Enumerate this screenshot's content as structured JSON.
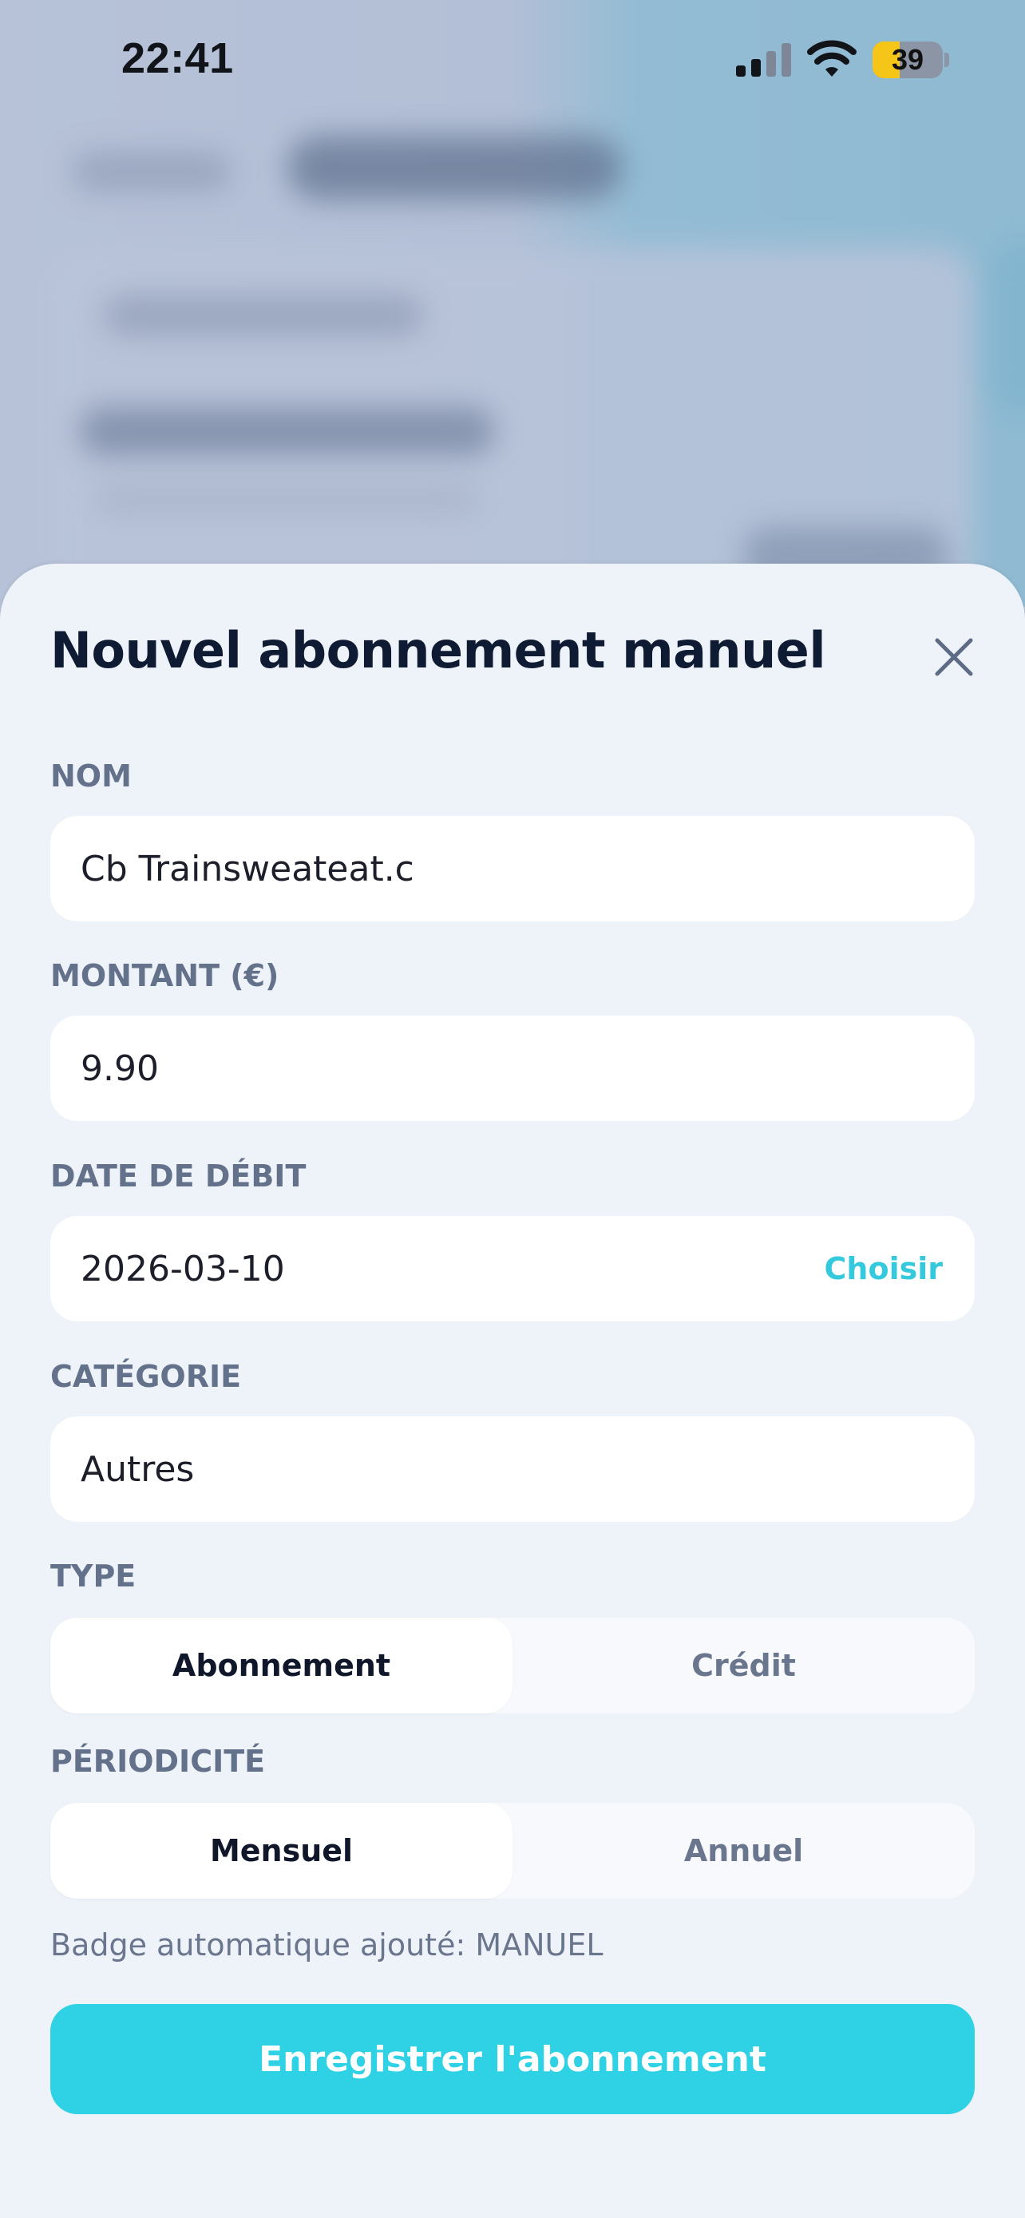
{
  "status_bar": {
    "time": "22:41",
    "battery_percent": "39",
    "battery_level": 0.39,
    "icons": [
      "signal-icon",
      "wifi-icon",
      "battery-icon"
    ]
  },
  "sheet": {
    "title": "Nouvel abonnement manuel",
    "close_icon": "close-icon",
    "fields": {
      "name": {
        "label": "NOM",
        "value": "Cb Trainsweateat.c"
      },
      "amount": {
        "label": "MONTANT (€)",
        "value": "9.90"
      },
      "date": {
        "label": "DATE DE DÉBIT",
        "value": "2026-03-10",
        "action": "Choisir"
      },
      "category": {
        "label": "CATÉGORIE",
        "value": "Autres"
      }
    },
    "type": {
      "label": "TYPE",
      "options": [
        "Abonnement",
        "Crédit"
      ],
      "selected": "Abonnement"
    },
    "periodicity": {
      "label": "PÉRIODICITÉ",
      "options": [
        "Mensuel",
        "Annuel"
      ],
      "selected": "Mensuel"
    },
    "note": "Badge automatique ajouté: MANUEL",
    "save_label": "Enregistrer l'abonnement"
  },
  "colors": {
    "accent": "#2fd2e4",
    "accent_text": "#35c9de",
    "title": "#0f1a33",
    "label": "#64718a",
    "sheet_bg": "#eef2f9",
    "battery_fill": "#f5c518"
  }
}
